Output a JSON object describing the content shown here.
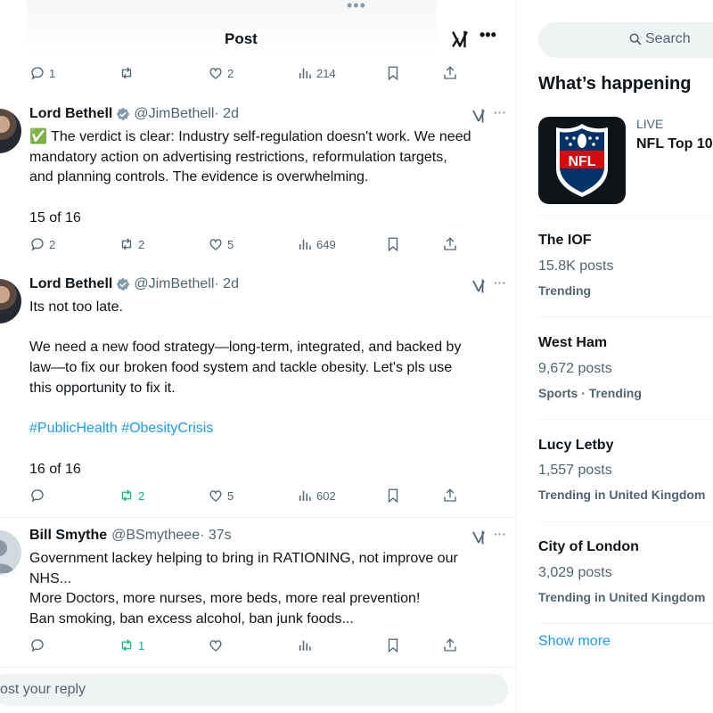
{
  "header": {
    "title": "Post"
  },
  "top_actions": {
    "replies": "1",
    "reposts": "",
    "likes": "2",
    "views": "214"
  },
  "tweets": [
    {
      "name": "Lord Bethell",
      "handle": "@JimBethell",
      "time": "· 2d",
      "lines": [
        "✅ The verdict is clear: Industry self-regulation doesn't work. We need",
        "mandatory action on advertising restrictions, reformulation targets,",
        "and planning controls. The evidence is overwhelming.",
        "",
        "15 of 16"
      ],
      "actions": {
        "replies": "2",
        "reposts": "2",
        "likes": "5",
        "views": "649"
      }
    },
    {
      "name": "Lord Bethell",
      "handle": "@JimBethell",
      "time": "· 2d",
      "lines": [
        "Its not too late.",
        "",
        "We need a new food strategy—long-term, integrated, and backed by",
        "law—to fix our broken food system and tackle obesity. Let's pls use",
        "this opportunity to fix it.",
        ""
      ],
      "hashtags": [
        "#PublicHealth",
        "#ObesityCrisis"
      ],
      "lines_after": [
        "",
        "16 of 16"
      ],
      "actions": {
        "replies": "",
        "reposts": "2",
        "likes": "5",
        "views": "602"
      }
    },
    {
      "name": "Bill Smythe",
      "handle": "@BSmytheee",
      "time": "· 37s",
      "lines": [
        "Government lackey helping to bring in RATIONING, not improve our",
        "NHS...",
        "More Doctors, more nurses, more beds, more real prevention!",
        "Ban smoking, ban excess alcohol, ban junk foods..."
      ],
      "actions": {
        "replies": "",
        "reposts": "1",
        "likes": "",
        "views": ""
      }
    }
  ],
  "reply": {
    "placeholder": "ost your reply"
  },
  "sidebar": {
    "search_label": "Search",
    "happening_title": "What’s happening",
    "featured": {
      "live": "LIVE",
      "title": "NFL Top 10",
      "logo_text": "NFL"
    },
    "trends": [
      {
        "name": "The IOF",
        "posts": "15.8K posts",
        "category": "Trending"
      },
      {
        "name": "West Ham",
        "posts": "9,672 posts",
        "category": "Sports · Trending"
      },
      {
        "name": "Lucy Letby",
        "posts": "1,557 posts",
        "category": "Trending in United Kingdom"
      },
      {
        "name": "City of London",
        "posts": "3,029 posts",
        "category": "Trending in United Kingdom"
      }
    ],
    "show_more": "Show more"
  },
  "colors": {
    "accent": "#1d9bf0",
    "repost_active": "#00ba7c",
    "muted": "#536471"
  }
}
